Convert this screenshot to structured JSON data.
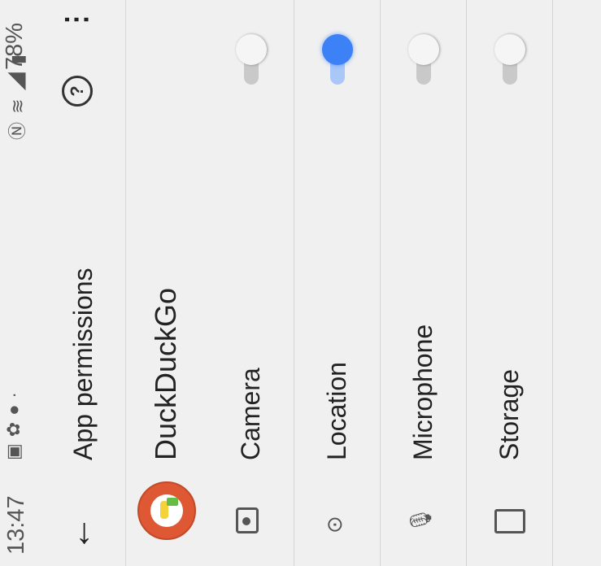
{
  "status_bar": {
    "time": "13:47",
    "battery": "78%",
    "left_icons": [
      "image-icon",
      "gear-icon",
      "circle-icon",
      "dot-icon"
    ],
    "right_icons": [
      "nfc-icon",
      "wifi-icon",
      "signal-icon",
      "battery-icon"
    ]
  },
  "app_bar": {
    "back_icon": "arrow-back-icon",
    "title": "App permissions",
    "help_icon": "help-icon",
    "more_icon": "more-vertical-icon"
  },
  "app": {
    "name": "DuckDuckGo",
    "logo_icon": "duckduckgo-logo"
  },
  "permissions": [
    {
      "label": "Camera",
      "icon": "camera-icon",
      "enabled": false
    },
    {
      "label": "Location",
      "icon": "location-icon",
      "enabled": true
    },
    {
      "label": "Microphone",
      "icon": "microphone-icon",
      "enabled": false
    },
    {
      "label": "Storage",
      "icon": "storage-icon",
      "enabled": false
    }
  ],
  "colors": {
    "background": "#f0f0f0",
    "switch_on": "#3c82f6",
    "switch_on_track": "#a9c8f7",
    "switch_off_track": "#c9c9c9",
    "logo": "#de5833"
  }
}
